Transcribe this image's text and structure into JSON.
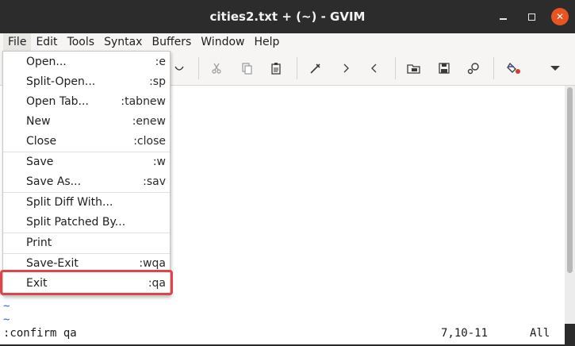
{
  "window": {
    "title": "cities2.txt + (~) - GVIM",
    "controls": [
      "minimize-icon",
      "maximize-icon",
      "close-icon"
    ]
  },
  "menubar": {
    "items": [
      "File",
      "Edit",
      "Tools",
      "Syntax",
      "Buffers",
      "Window",
      "Help"
    ],
    "active": "File"
  },
  "toolbar": {
    "icons": [
      "redo-icon",
      "cut-icon",
      "copy-icon",
      "paste-icon",
      "find-replace-icon",
      "find-next-icon",
      "find-prev-icon",
      "load-session-icon",
      "save-session-icon",
      "run-script-icon",
      "make-icon",
      "more-chevron-icon"
    ]
  },
  "file_menu": {
    "items": [
      {
        "label": "Open...",
        "accel": ":e"
      },
      {
        "label": "Split-Open...",
        "accel": ":sp"
      },
      {
        "label": "Open Tab...",
        "accel": ":tabnew"
      },
      {
        "label": "New",
        "accel": ":enew"
      },
      {
        "label": "Close",
        "accel": ":close"
      },
      {
        "label": "Save",
        "accel": ":w"
      },
      {
        "label": "Save As...",
        "accel": ":sav"
      },
      {
        "label": "Split Diff With...",
        "accel": ""
      },
      {
        "label": "Split Patched By...",
        "accel": ""
      },
      {
        "label": "Print",
        "accel": ""
      },
      {
        "label": "Save-Exit",
        "accel": ":wqa"
      },
      {
        "label": "Exit",
        "accel": ":qa"
      }
    ],
    "highlighted": "Exit"
  },
  "editor": {
    "tildes": [
      "~",
      "~"
    ]
  },
  "statusline": {
    "command": ":confirm qa",
    "position": "7,10-11",
    "percent": "All"
  },
  "colors": {
    "highlight_border": "#e2434b",
    "tilde": "#3b61d6",
    "close_button": "#e95420"
  }
}
